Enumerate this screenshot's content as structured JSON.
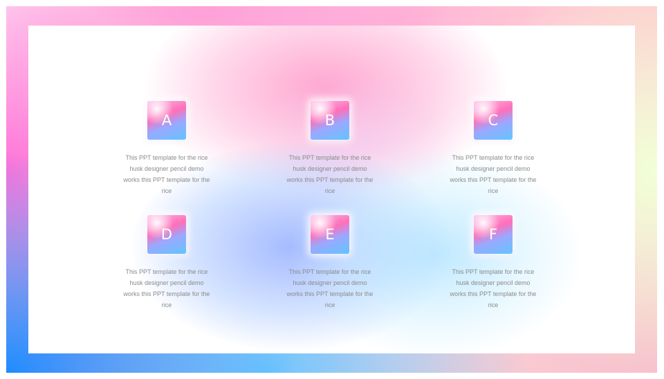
{
  "items": [
    {
      "letter": "A",
      "text": "This PPT template for the rice husk designer pencil demo works this PPT template for the rice"
    },
    {
      "letter": "B",
      "text": "This PPT template for the rice husk designer pencil demo works this PPT template for the rice"
    },
    {
      "letter": "C",
      "text": "This PPT template for the rice husk designer pencil demo works this PPT template for the rice"
    },
    {
      "letter": "D",
      "text": "This PPT template for the rice husk designer pencil demo works this PPT template for the rice"
    },
    {
      "letter": "E",
      "text": "This PPT template for the rice husk designer pencil demo works this PPT template for the rice"
    },
    {
      "letter": "F",
      "text": "This PPT template for the rice husk designer pencil demo works this PPT template for the rice"
    }
  ],
  "colors": {
    "text": "#8a8a8a",
    "tile_pink": "#ff6fb8",
    "tile_blue": "#63c4ff",
    "frame_blue": "#1e8cff",
    "frame_pink": "#ff74d8"
  }
}
